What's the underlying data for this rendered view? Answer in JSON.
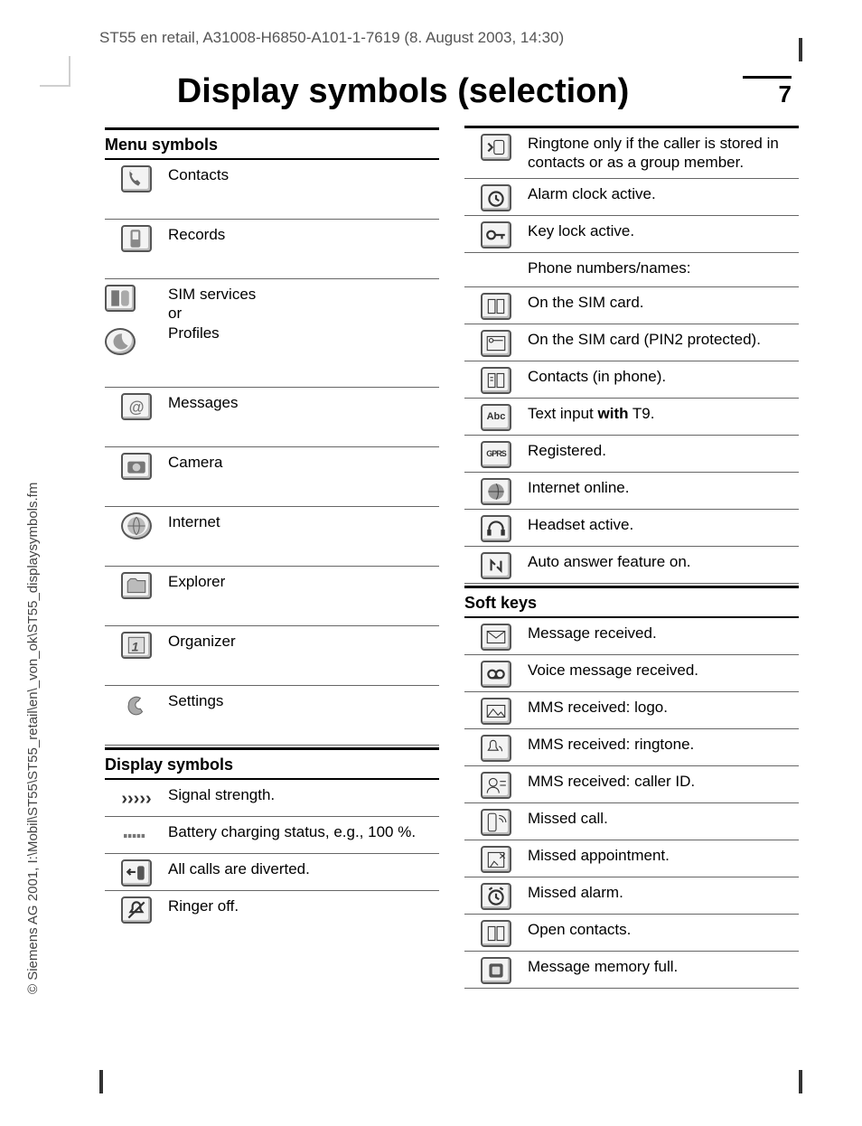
{
  "header": "ST55 en retail, A31008-H6850-A101-1-7619 (8. August 2003, 14:30)",
  "title": "Display symbols (selection)",
  "page_number": "7",
  "sidebar_copy": "© Siemens AG 2001, I:\\Mobil\\ST55\\ST55_retail\\en\\_von_ok\\ST55_displaysymbols.fm",
  "sections": {
    "menu_symbols": {
      "heading": "Menu symbols",
      "items": [
        {
          "icon": "contacts-icon",
          "label": "Contacts"
        },
        {
          "icon": "records-icon",
          "label": "Records"
        },
        {
          "icon": "sim-services-icon",
          "label": "SIM services\nor\nProfiles"
        },
        {
          "icon": "messages-icon",
          "label": "Messages"
        },
        {
          "icon": "camera-icon",
          "label": "Camera"
        },
        {
          "icon": "internet-icon",
          "label": "Internet"
        },
        {
          "icon": "explorer-icon",
          "label": "Explorer"
        },
        {
          "icon": "organizer-icon",
          "label": "Organizer"
        },
        {
          "icon": "settings-icon",
          "label": "Settings"
        }
      ]
    },
    "display_symbols": {
      "heading": "Display symbols",
      "items": [
        {
          "icon": "signal-icon",
          "label": "Signal strength."
        },
        {
          "icon": "battery-icon",
          "label": "Battery charging status, e.g., 100 %."
        },
        {
          "icon": "divert-icon",
          "label": "All calls are diverted."
        },
        {
          "icon": "ringer-off-icon",
          "label": "Ringer off."
        }
      ]
    },
    "display_symbols_cont": {
      "items": [
        {
          "icon": "ringtone-caller-icon",
          "label": "Ringtone only if the caller is stored in contacts or as a group member."
        },
        {
          "icon": "alarm-icon",
          "label": "Alarm clock active."
        },
        {
          "icon": "keylock-icon",
          "label": "Key lock active."
        },
        {
          "icon": "",
          "label": "Phone numbers/names:"
        },
        {
          "icon": "sim-card-icon",
          "label": "On the SIM card."
        },
        {
          "icon": "sim-pin2-icon",
          "label": "On the SIM card (PIN2 protected)."
        },
        {
          "icon": "contacts-phone-icon",
          "label": "Contacts (in phone)."
        },
        {
          "icon": "t9-icon",
          "label_html": "Text input <b>with</b> T9."
        },
        {
          "icon": "gprs-icon",
          "label": "Registered."
        },
        {
          "icon": "online-icon",
          "label": "Internet online."
        },
        {
          "icon": "headset-icon",
          "label": "Headset active."
        },
        {
          "icon": "autoanswer-icon",
          "label": "Auto answer feature on."
        }
      ]
    },
    "soft_keys": {
      "heading": "Soft keys",
      "items": [
        {
          "icon": "msg-recv-icon",
          "label": "Message received."
        },
        {
          "icon": "voicemsg-icon",
          "label": "Voice message received."
        },
        {
          "icon": "mms-logo-icon",
          "label": "MMS received: logo."
        },
        {
          "icon": "mms-ring-icon",
          "label": "MMS received: ringtone."
        },
        {
          "icon": "mms-cid-icon",
          "label": "MMS received: caller ID."
        },
        {
          "icon": "missed-call-icon",
          "label": "Missed call."
        },
        {
          "icon": "missed-appt-icon",
          "label": "Missed appointment."
        },
        {
          "icon": "missed-alarm-icon",
          "label": "Missed alarm."
        },
        {
          "icon": "open-contacts-icon",
          "label": "Open contacts."
        },
        {
          "icon": "memfull-icon",
          "label": "Message memory full."
        }
      ]
    }
  }
}
